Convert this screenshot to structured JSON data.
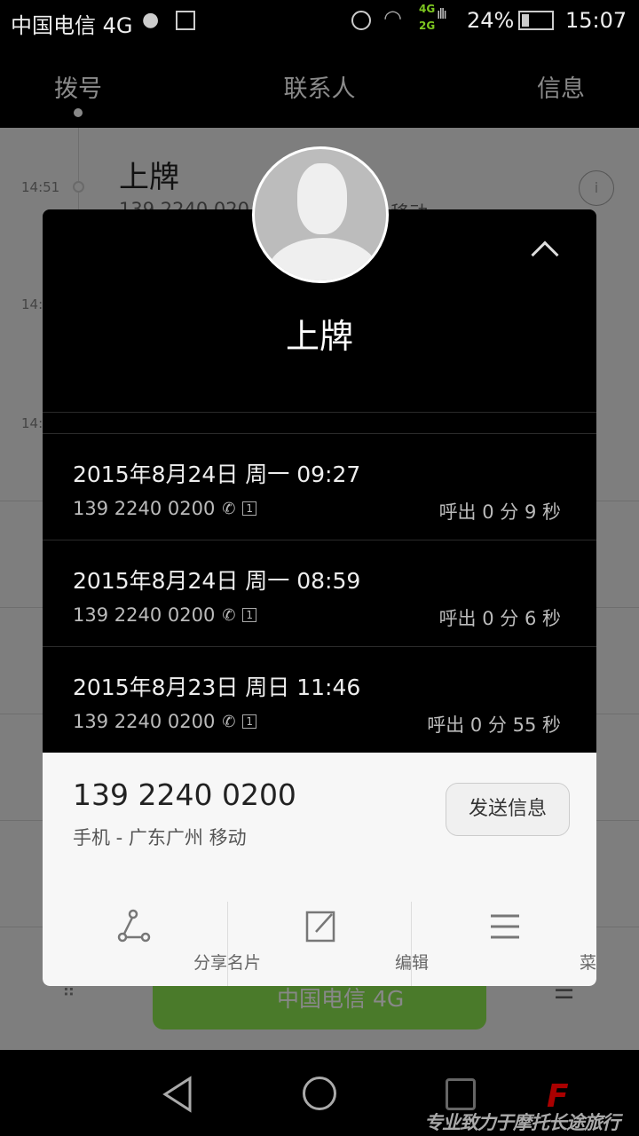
{
  "status_bar": {
    "carrier": "中国电信 4G",
    "net_top": "4G",
    "net_bottom": "2G",
    "battery": "24%",
    "battery_level": 0.24,
    "time": "15:07"
  },
  "tabs": [
    {
      "label": "拨号",
      "active": true
    },
    {
      "label": "联系人"
    },
    {
      "label": "信息"
    }
  ],
  "background_list": {
    "first_name": "上牌",
    "first_number": "139 2240 020",
    "first_location": "移动",
    "times": [
      "14:51",
      "14:",
      "14:"
    ],
    "dial_button": "中国电信 4G"
  },
  "contact": {
    "name": "上牌",
    "number": "139 2240 0200",
    "description": "手机 - 广东广州 移动",
    "send_message": "发送信息"
  },
  "call_log": [
    {
      "date": "2015年8月24日 周一 09:27",
      "number": "139 2240 0200",
      "duration": "呼出 0 分 9 秒"
    },
    {
      "date": "2015年8月24日 周一 08:59",
      "number": "139 2240 0200",
      "duration": "呼出 0 分 6 秒"
    },
    {
      "date": "2015年8月23日 周日 11:46",
      "number": "139 2240 0200",
      "duration": "呼出 0 分 55 秒"
    }
  ],
  "actions": [
    {
      "label": "分享名片",
      "icon": "share-icon"
    },
    {
      "label": "编辑",
      "icon": "edit-icon"
    },
    {
      "label": "菜单",
      "icon": "menu-icon"
    }
  ],
  "watermark": "专业致力于摩托长途旅行",
  "colors": {
    "dial_green": "#4a7a2a",
    "net_green": "#7ec820"
  }
}
